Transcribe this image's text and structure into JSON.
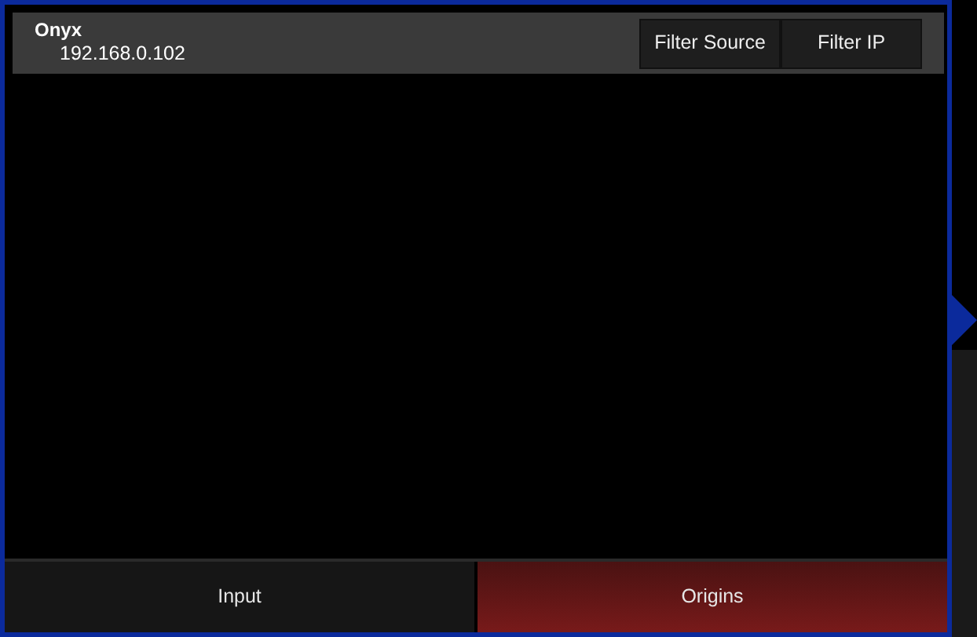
{
  "header": {
    "title": "Onyx",
    "address": "192.168.0.102"
  },
  "filter_buttons": [
    {
      "label": "Filter Source"
    },
    {
      "label": "Filter IP"
    }
  ],
  "tabs": [
    {
      "label": "Input",
      "selected": false
    },
    {
      "label": "Origins",
      "selected": true
    }
  ]
}
